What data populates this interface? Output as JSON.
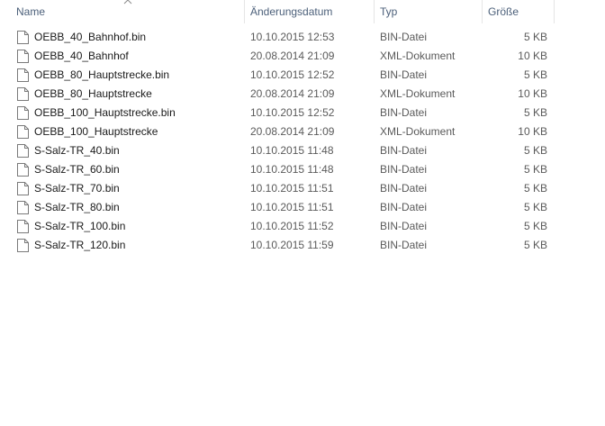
{
  "columns": {
    "name": "Name",
    "date": "Änderungsdatum",
    "type": "Typ",
    "size": "Größe"
  },
  "sort": {
    "column": "name",
    "direction": "ascending",
    "indicator_icon": "chevron-up-icon"
  },
  "files": [
    {
      "name": "OEBB_40_Bahnhof.bin",
      "date": "10.10.2015 12:53",
      "type": "BIN-Datei",
      "size": "5 KB",
      "icon": "file-icon"
    },
    {
      "name": "OEBB_40_Bahnhof",
      "date": "20.08.2014 21:09",
      "type": "XML-Dokument",
      "size": "10 KB",
      "icon": "file-icon"
    },
    {
      "name": "OEBB_80_Hauptstrecke.bin",
      "date": "10.10.2015 12:52",
      "type": "BIN-Datei",
      "size": "5 KB",
      "icon": "file-icon"
    },
    {
      "name": "OEBB_80_Hauptstrecke",
      "date": "20.08.2014 21:09",
      "type": "XML-Dokument",
      "size": "10 KB",
      "icon": "file-icon"
    },
    {
      "name": "OEBB_100_Hauptstrecke.bin",
      "date": "10.10.2015 12:52",
      "type": "BIN-Datei",
      "size": "5 KB",
      "icon": "file-icon"
    },
    {
      "name": "OEBB_100_Hauptstrecke",
      "date": "20.08.2014 21:09",
      "type": "XML-Dokument",
      "size": "10 KB",
      "icon": "file-icon"
    },
    {
      "name": "S-Salz-TR_40.bin",
      "date": "10.10.2015 11:48",
      "type": "BIN-Datei",
      "size": "5 KB",
      "icon": "file-icon"
    },
    {
      "name": "S-Salz-TR_60.bin",
      "date": "10.10.2015 11:48",
      "type": "BIN-Datei",
      "size": "5 KB",
      "icon": "file-icon"
    },
    {
      "name": "S-Salz-TR_70.bin",
      "date": "10.10.2015 11:51",
      "type": "BIN-Datei",
      "size": "5 KB",
      "icon": "file-icon"
    },
    {
      "name": "S-Salz-TR_80.bin",
      "date": "10.10.2015 11:51",
      "type": "BIN-Datei",
      "size": "5 KB",
      "icon": "file-icon"
    },
    {
      "name": "S-Salz-TR_100.bin",
      "date": "10.10.2015 11:52",
      "type": "BIN-Datei",
      "size": "5 KB",
      "icon": "file-icon"
    },
    {
      "name": "S-Salz-TR_120.bin",
      "date": "10.10.2015 11:59",
      "type": "BIN-Datei",
      "size": "5 KB",
      "icon": "file-icon"
    }
  ]
}
